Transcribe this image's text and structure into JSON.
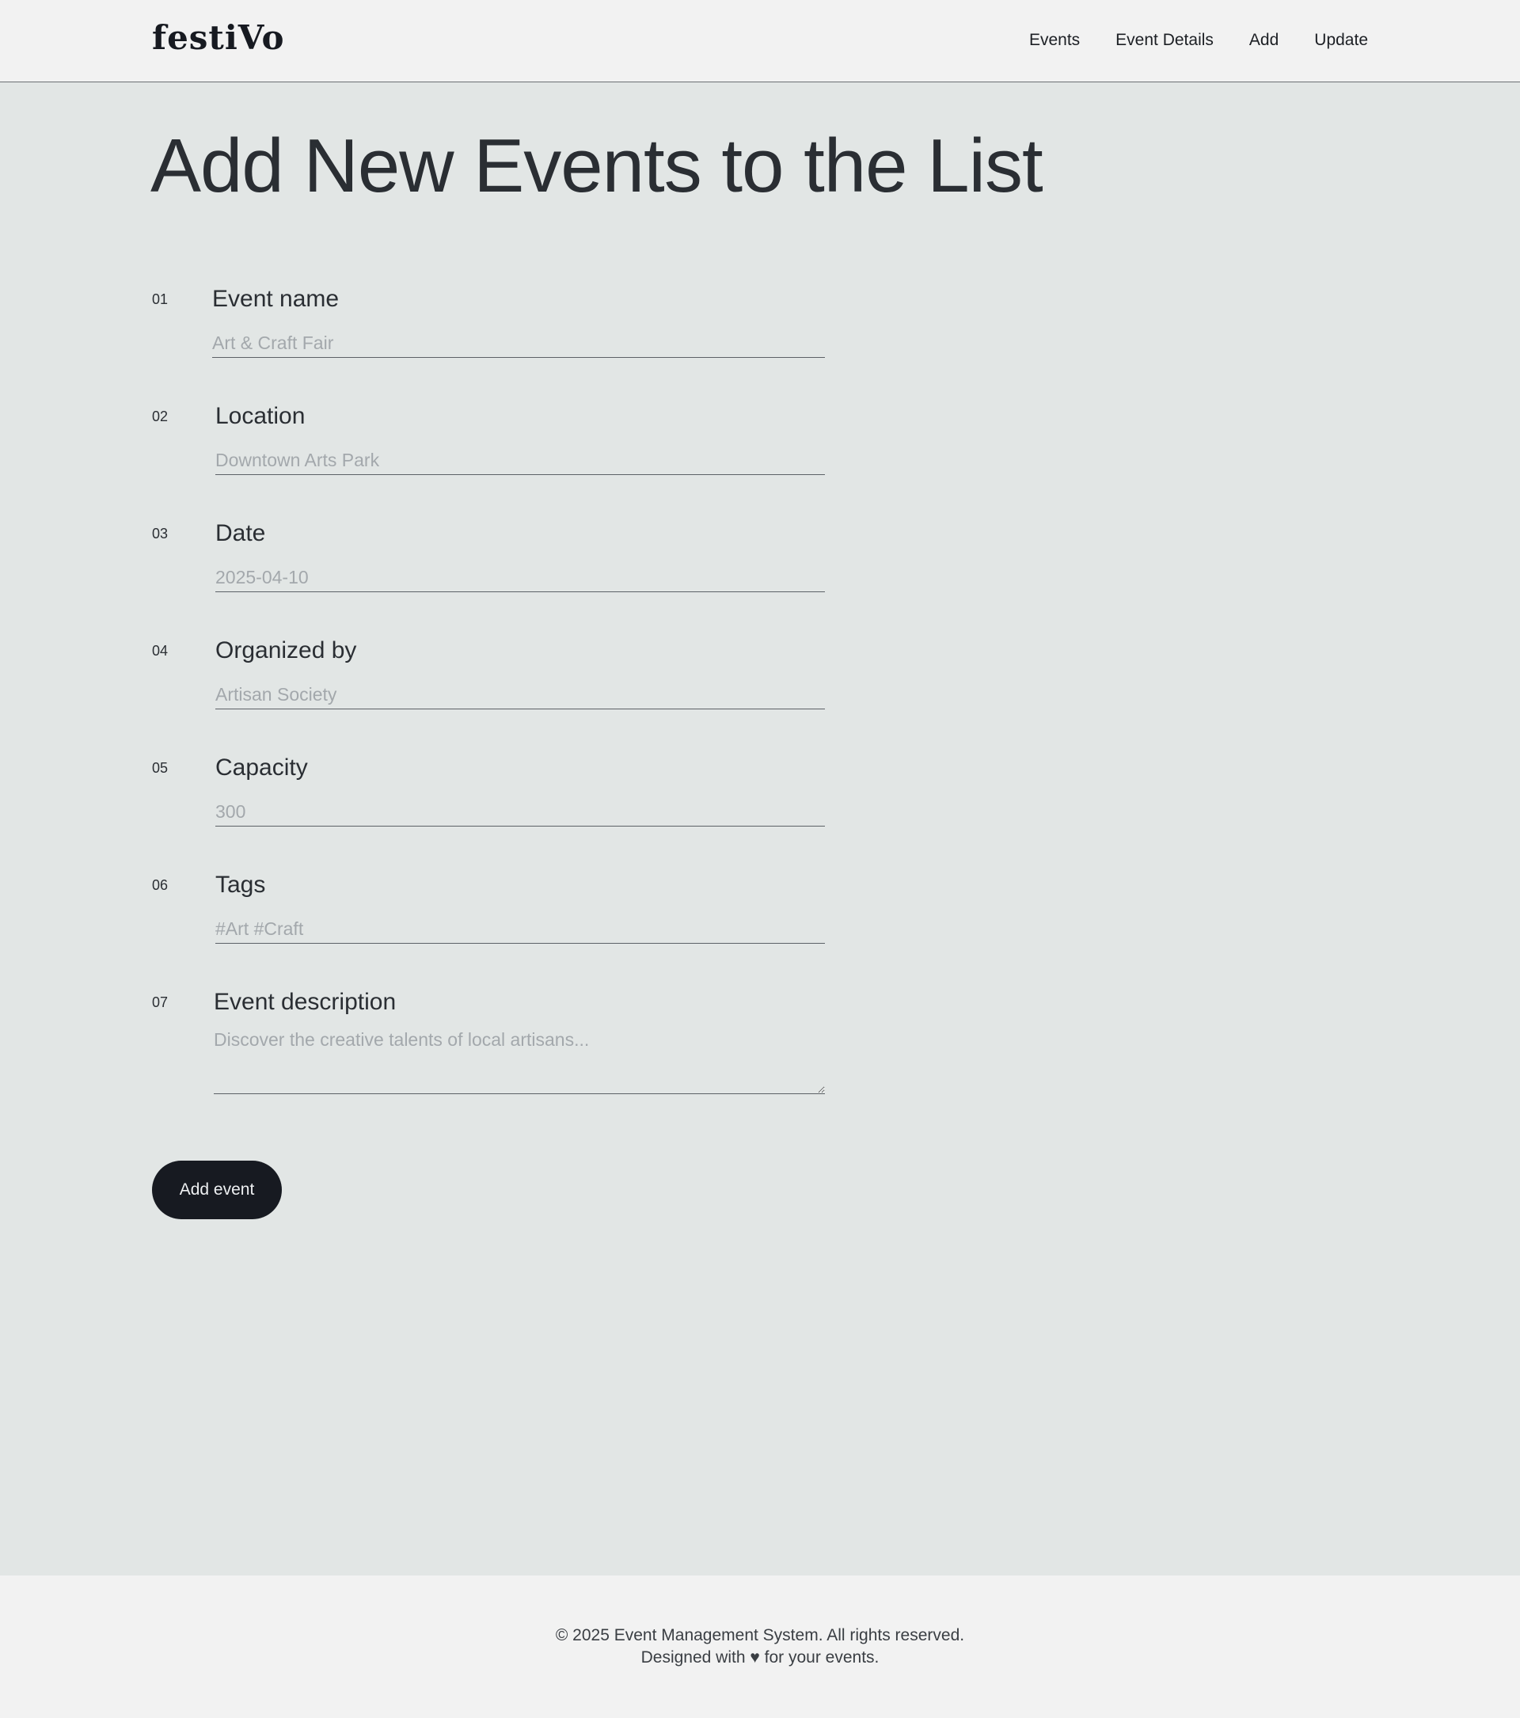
{
  "brand": {
    "logo_text": "festiVo"
  },
  "nav": {
    "items": [
      "Events",
      "Event Details",
      "Add",
      "Update"
    ]
  },
  "page": {
    "title": "Add New Events to the List"
  },
  "form": {
    "fields": [
      {
        "number": "01",
        "label": "Event name",
        "placeholder": "Art & Craft Fair"
      },
      {
        "number": "02",
        "label": "Location",
        "placeholder": "Downtown Arts Park"
      },
      {
        "number": "03",
        "label": "Date",
        "placeholder": "2025-04-10"
      },
      {
        "number": "04",
        "label": "Organized by",
        "placeholder": "Artisan Society"
      },
      {
        "number": "05",
        "label": "Capacity",
        "placeholder": "300"
      },
      {
        "number": "06",
        "label": "Tags",
        "placeholder": "#Art #Craft"
      },
      {
        "number": "07",
        "label": "Event description",
        "placeholder": "Discover the creative talents of local artisans..."
      }
    ],
    "submit_label": "Add event"
  },
  "footer": {
    "copyright": "© 2025 Event Management System. All rights reserved.",
    "tagline": "Designed with ♥ for your events."
  },
  "colors": {
    "header_bg": "#f2f2f2",
    "page_bg": "#e2e6e5",
    "button_bg": "#171a21",
    "text": "#2a2e33",
    "placeholder": "#a3a8ac"
  }
}
